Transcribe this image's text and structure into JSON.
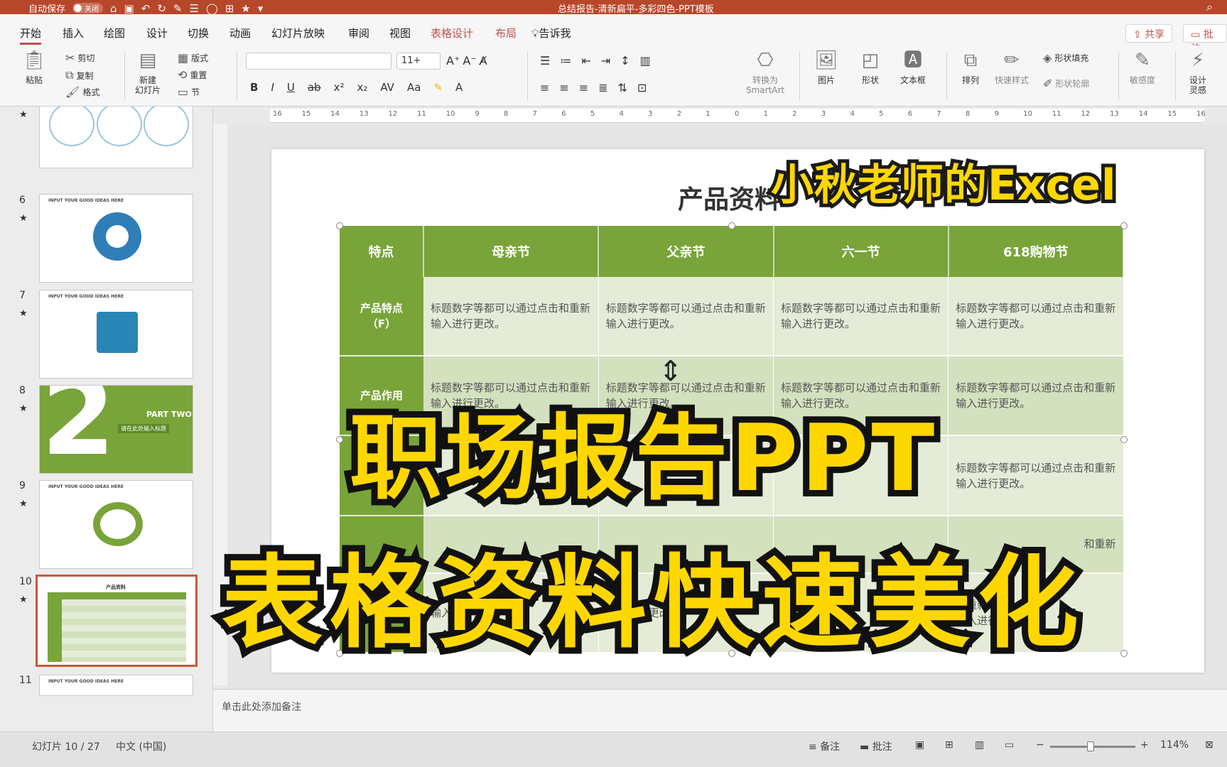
{
  "titlebar": {
    "autosave_label": "自动保存",
    "autosave_state": "关闭",
    "doc_title": "总结报告-清新扁平-多彩四色-PPT模板"
  },
  "tabs": [
    {
      "label": "开始",
      "state": "active"
    },
    {
      "label": "插入"
    },
    {
      "label": "绘图"
    },
    {
      "label": "设计"
    },
    {
      "label": "切换"
    },
    {
      "label": "动画"
    },
    {
      "label": "幻灯片放映"
    },
    {
      "label": "审阅"
    },
    {
      "label": "视图"
    },
    {
      "label": "表格设计",
      "state": "accent"
    },
    {
      "label": "布局",
      "state": "accent"
    },
    {
      "label": "告诉我"
    }
  ],
  "share": {
    "share_label": "共享",
    "comment_label": "批注"
  },
  "ribbon": {
    "paste": "粘贴",
    "cut": "剪切",
    "copy": "复制",
    "format": "格式",
    "new_slide": "新建\n幻灯片",
    "layout": "版式",
    "reset": "重置",
    "section": "节",
    "font_size": "11+",
    "convert_smartart": "转换为\nSmartArt",
    "picture": "图片",
    "shape": "形状",
    "textbox": "文本框",
    "arrange": "排列",
    "quick_styles": "快速样式",
    "shape_fill": "形状填充",
    "shape_outline": "形状轮廓",
    "sensitivity": "敏感度",
    "designer": "设计\n灵感"
  },
  "ruler": {
    "ticks": [
      "16",
      "15",
      "14",
      "13",
      "12",
      "11",
      "10",
      "9",
      "8",
      "7",
      "6",
      "5",
      "4",
      "3",
      "2",
      "1",
      "0",
      "1",
      "2",
      "3",
      "4",
      "5",
      "6",
      "7",
      "8",
      "9",
      "10",
      "11",
      "12",
      "13",
      "14",
      "15",
      "16"
    ]
  },
  "slides": [
    {
      "num": "6",
      "title": "INPUT YOUR GOOD IDEAS HERE"
    },
    {
      "num": "7",
      "title": "INPUT YOUR GOOD IDEAS HERE"
    },
    {
      "num": "8",
      "big": "2",
      "part": "PART TWO",
      "sub": "请在此处输入标题"
    },
    {
      "num": "9",
      "title": "INPUT YOUR GOOD IDEAS HERE"
    },
    {
      "num": "10",
      "title": "产品资料"
    },
    {
      "num": "11",
      "title": "INPUT YOUR GOOD IDEAS HERE"
    }
  ],
  "slide": {
    "title": "产品资料",
    "table": {
      "headers": [
        "特点",
        "母亲节",
        "父亲节",
        "六一节",
        "618购物节"
      ],
      "rows": [
        {
          "head": "产品特点\n（F）",
          "cells": [
            "标题数字等都可以通过点击和重新输入进行更改。",
            "标题数字等都可以通过点击和重新输入进行更改。",
            "标题数字等都可以通过点击和重新输入进行更改。",
            "标题数字等都可以通过点击和重新输入进行更改。"
          ]
        },
        {
          "head": "产品作用",
          "cells": [
            "标题数字等都可以通过点击和重新输入进行更改。",
            "标题数字等都可以通过点击和重新输入进行更改。",
            "标题数字等都可以通过点击和重新输入进行更改。",
            "标题数字等都可以通过点击和重新输入进行更改。"
          ]
        },
        {
          "head": "",
          "cells": [
            "",
            "",
            "",
            "标题数字等都可以通过点击和重新输入进行更改。"
          ]
        },
        {
          "head": "",
          "cells": [
            "",
            "",
            "",
            "和重新"
          ]
        },
        {
          "head": "",
          "cells": [
            "输入进行更改。",
            "输入进行更改。",
            "输入进行更改。",
            "和重新\n输入进行更改。"
          ]
        }
      ]
    }
  },
  "notes": {
    "placeholder": "单击此处添加备注"
  },
  "status": {
    "slide_count": "幻灯片 10 / 27",
    "language": "中文 (中国)",
    "notes_btn": "备注",
    "comments_btn": "批注",
    "zoom": "114%"
  },
  "overlay": {
    "brand": "小秋老师的Excel",
    "line1": "职场报告PPT",
    "line2": "表格资料快速美化"
  },
  "colors": {
    "accent": "#b7472a",
    "table_green": "#79a43a",
    "overlay_yellow": "#ffd700"
  }
}
